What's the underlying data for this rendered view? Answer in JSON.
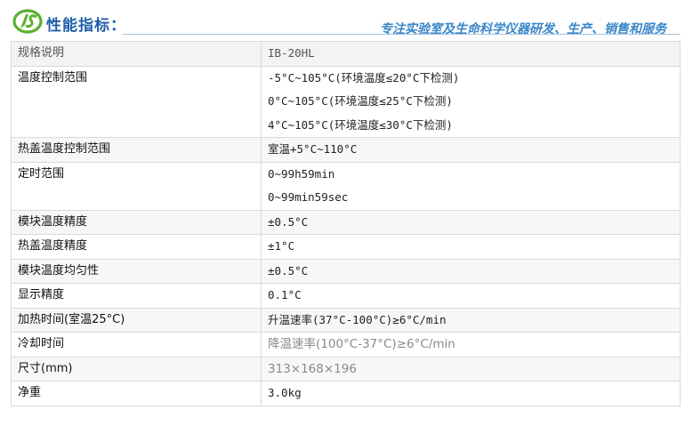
{
  "header": {
    "title": "性能指标：",
    "slogan": "专注实验室及生命科学仪器研发、生产、销售和服务"
  },
  "table": {
    "header": {
      "label": "规格说明",
      "value": "IB-20HL"
    },
    "rows": [
      {
        "label": "温度控制范围",
        "values": [
          "-5°C~105°C(环境温度≤20°C下检测)",
          "0°C~105°C(环境温度≤25°C下检测)",
          "4°C~105°C(环境温度≤30°C下检测)"
        ]
      },
      {
        "label": "热盖温度控制范围",
        "values": [
          "室温+5°C~110°C"
        ]
      },
      {
        "label": "定时范围",
        "values": [
          "0~99h59min",
          "0~99min59sec"
        ]
      },
      {
        "label": "模块温度精度",
        "values": [
          "±0.5°C"
        ]
      },
      {
        "label": "热盖温度精度",
        "values": [
          "±1°C"
        ]
      },
      {
        "label": "模块温度均匀性",
        "values": [
          "±0.5°C"
        ]
      },
      {
        "label": "显示精度",
        "values": [
          "0.1°C"
        ]
      },
      {
        "label": "加热时间(室温25°C)",
        "values": [
          "升温速率(37°C-100°C)≥6°C/min"
        ]
      },
      {
        "label": "冷却时间",
        "values": [
          "降温速率(100°C-37°C)≥6°C/min"
        ]
      },
      {
        "label": "尺寸(mm)",
        "values": [
          "313×168×196"
        ]
      },
      {
        "label": "净重",
        "values": [
          "3.0kg"
        ]
      }
    ]
  },
  "colors": {
    "title": "#1f5fa8",
    "slogan": "#3a86c8",
    "logo_green": "#5ab030",
    "grid": "#d9d9d9"
  }
}
